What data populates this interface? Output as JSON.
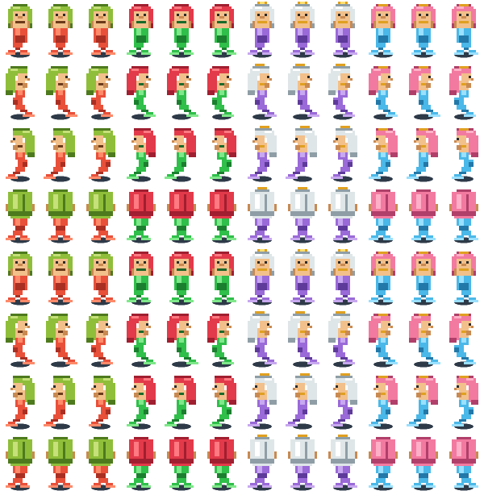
{
  "sheet": {
    "name": "mermaid-sprite-sheet",
    "columns": 12,
    "rows": 8
  },
  "characters": [
    {
      "name": "green-haired-mermaid",
      "hair": "#8fbe3a",
      "hairDark": "#4e7a1e",
      "hairLight": "#c6e07a",
      "skin": "#f2c08a",
      "skinDark": "#c98a52",
      "tail": "#e8503a",
      "tailDark": "#a92f22",
      "tailLight": "#ff8a6a",
      "accent": "#6a3a1a",
      "accessory": "none"
    },
    {
      "name": "red-haired-mermaid",
      "hair": "#e23a4a",
      "hairDark": "#a01f30",
      "hairLight": "#ff7a82",
      "skin": "#f2c08a",
      "skinDark": "#c98a52",
      "tail": "#2fbf4a",
      "tailDark": "#1a7f2e",
      "tailLight": "#7fe88a",
      "accent": "#1a6a2a",
      "accessory": "none"
    },
    {
      "name": "silver-haired-mermaid",
      "hair": "#dfe6e8",
      "hairDark": "#8f9ea6",
      "hairLight": "#ffffff",
      "skin": "#f2c08a",
      "skinDark": "#c98a52",
      "tail": "#9a6ad8",
      "tailDark": "#5e3a9a",
      "tailLight": "#c8a8f0",
      "accent": "#e0a020",
      "accessory": "crown"
    },
    {
      "name": "pink-haired-mermaid",
      "hair": "#f27aa0",
      "hairDark": "#b0406a",
      "hairLight": "#ffb0c8",
      "skin": "#f2c08a",
      "skinDark": "#c98a52",
      "tail": "#4ab8e8",
      "tailDark": "#2278a8",
      "tailLight": "#9ae0ff",
      "accent": "#e0a020",
      "accessory": "tiara"
    }
  ],
  "rowPoses": [
    "front",
    "side-right",
    "side-left",
    "back",
    "front",
    "side-right",
    "side-left",
    "back"
  ],
  "shadowColor": "#2e3a48"
}
